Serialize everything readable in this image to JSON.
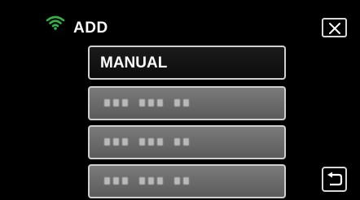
{
  "header": {
    "title": "ADD",
    "wifi_icon": "wifi-icon",
    "close_icon": "close-icon",
    "accent_color": "#35b34a"
  },
  "list": {
    "items": [
      {
        "label": "MANUAL",
        "type": "manual"
      },
      {
        "label": "",
        "type": "access-point-obscured"
      },
      {
        "label": "",
        "type": "access-point-obscured"
      },
      {
        "label": "",
        "type": "access-point-obscured"
      }
    ]
  },
  "footer": {
    "back_icon": "return-icon"
  }
}
